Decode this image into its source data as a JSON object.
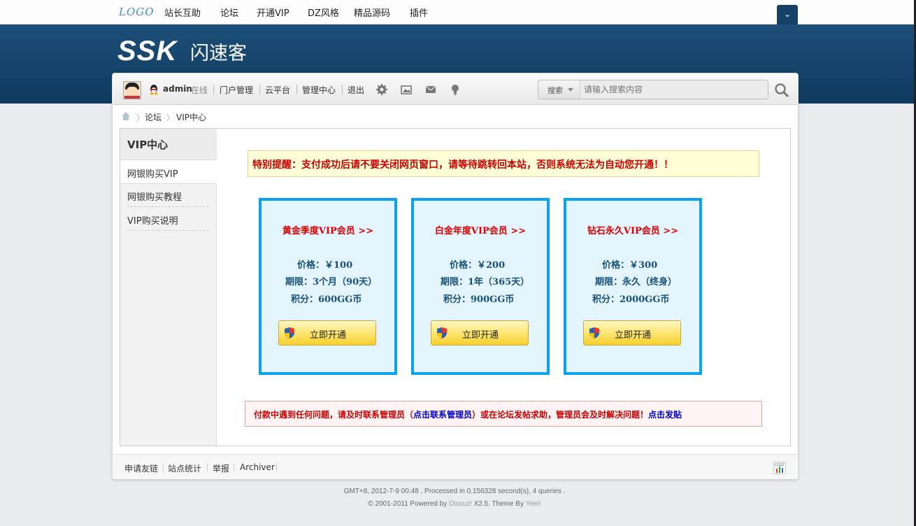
{
  "topbar": {
    "logo": "LOGO",
    "nav": [
      "站长互助",
      "论坛",
      "开通VIP",
      "DZ风格",
      "精品源码",
      "插件"
    ]
  },
  "header": {
    "brand": "SSK",
    "brand_cn": "闪速客"
  },
  "toolbar": {
    "username": "admin",
    "status": "在线",
    "links": [
      "门户管理",
      "云平台",
      "管理中心",
      "退出"
    ],
    "icons": [
      "gear-icon",
      "image-icon",
      "mail-icon",
      "bulb-icon"
    ],
    "search": {
      "type": "搜索",
      "placeholder": "请输入搜索内容"
    }
  },
  "breadcrumb": [
    "论坛",
    "VIP中心"
  ],
  "sidebar": {
    "title": "VIP中心",
    "items": [
      "网银购买VIP",
      "网银购买教程",
      "VIP购买说明"
    ]
  },
  "notice": "特别提醒：支付成功后请不要关闭网页窗口，请等待跳转回本站，否则系统无法为自动您开通！！",
  "plans": [
    {
      "title": "黄金季度VIP会员 >>",
      "price": "价格：￥100",
      "period": "期限：3个月（90天）",
      "points": "积分：600GG币",
      "button": "立即开通"
    },
    {
      "title": "白金年度VIP会员 >>",
      "price": "价格：￥200",
      "period": "期限：1年（365天）",
      "points": "积分：900GG币",
      "button": "立即开通"
    },
    {
      "title": "钻石永久VIP会员 >>",
      "price": "价格：￥300",
      "period": "期限：永久（终身）",
      "points": "积分：2000GG币",
      "button": "立即开通"
    }
  ],
  "help": {
    "part1": "付款中遇到任何问题，请及时联系管理员（",
    "link1": "点击联系管理员",
    "part2": "）或在论坛发帖求助，管理员会及时解决问题！",
    "link2": "点击发贴"
  },
  "wrap_footer": {
    "links": [
      "申请友链",
      "站点统计",
      "举报",
      "Archiver"
    ],
    "stat_label": "cnzz"
  },
  "page_footer": {
    "line1": "GMT+8, 2012-7-9 00:48 , Processed in 0.156328 second(s), 4 queries .",
    "line2_a": "© 2001-2011 Powered by ",
    "line2_link1": "Discuz!",
    "line2_b": " X2.5. Theme By ",
    "line2_link2": "Yeei!"
  },
  "colors": {
    "header_bg": "#0f3a60",
    "card_border": "#08a2ef",
    "card_bg": "#e4f4fc",
    "accent_red": "#cc0000",
    "link_blue": "#0000cc"
  }
}
